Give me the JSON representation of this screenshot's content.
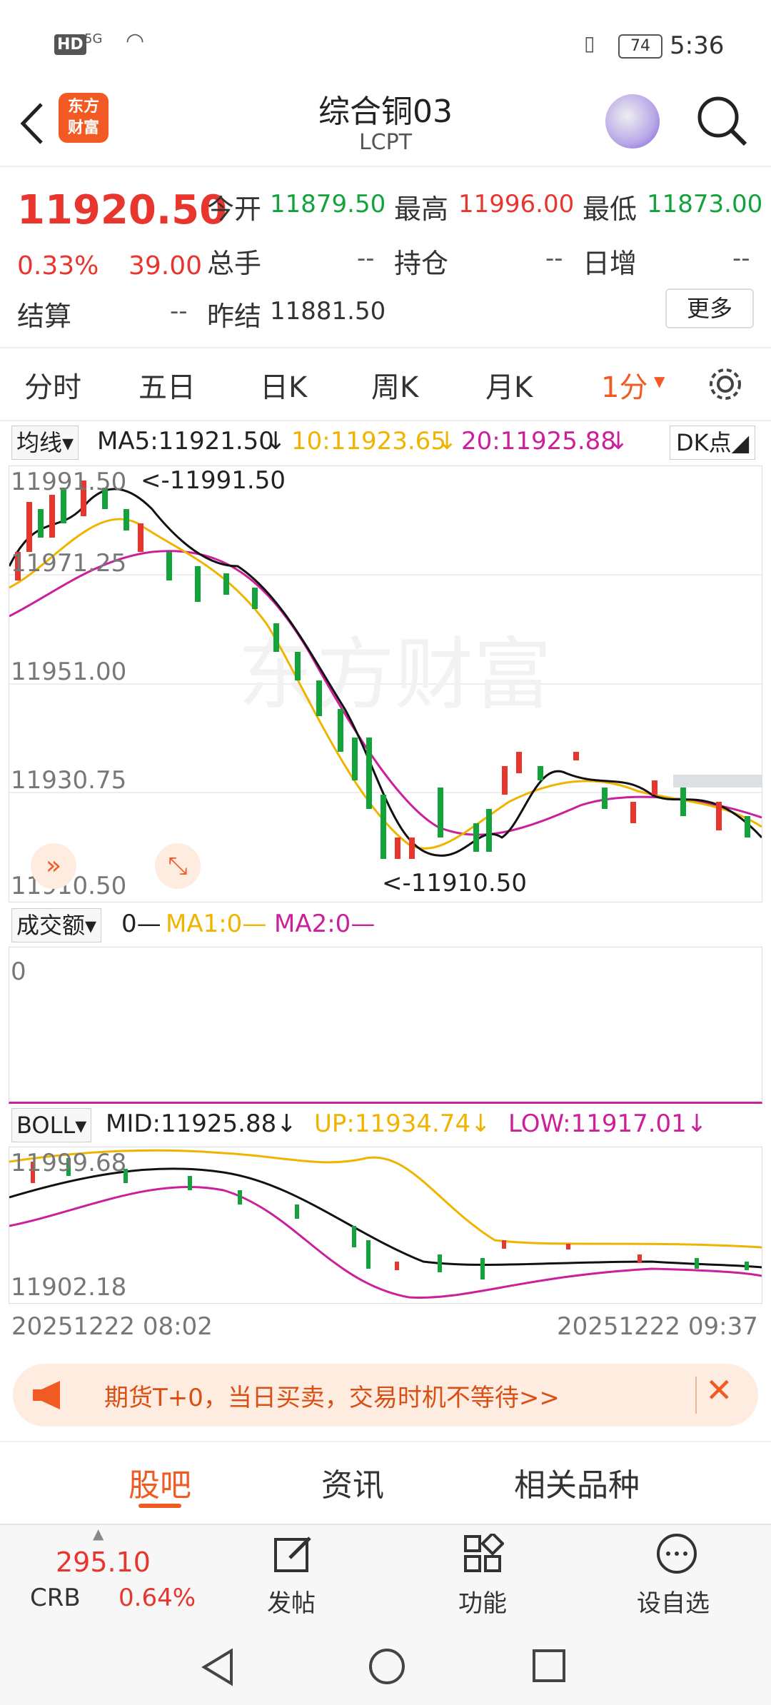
{
  "status": {
    "net": "HD",
    "signal": "5G",
    "battery": "74",
    "time": "5:36"
  },
  "header": {
    "logo_line1": "东方",
    "logo_line2": "财富",
    "title": "综合铜03",
    "code": "LCPT"
  },
  "quote": {
    "price": "11920.50",
    "change_pct": "0.33%",
    "change": "39.00",
    "open_label": "今开",
    "open": "11879.50",
    "high_label": "最高",
    "high": "11996.00",
    "low_label": "最低",
    "low": "11873.00",
    "volume_label": "总手",
    "volume": "--",
    "position_label": "持仓",
    "position": "--",
    "daily_inc_label": "日增",
    "daily_inc": "--",
    "settle_label": "结算",
    "settle": "--",
    "prev_settle_label": "昨结",
    "prev_settle": "11881.50",
    "more_button": "更多"
  },
  "tabs": {
    "t1": "分时",
    "t2": "五日",
    "t3": "日K",
    "t4": "周K",
    "t5": "月K",
    "t6": "1分"
  },
  "ma_legend": {
    "selector": "均线",
    "ma5": "MA5:11921.50",
    "ma10": "10:11923.65",
    "ma20": "20:11925.88",
    "dk": "DK点"
  },
  "main_chart": {
    "y1": "11991.50",
    "y2": "11971.25",
    "y3": "11951.00",
    "y4": "11930.75",
    "y5": "11910.50",
    "max_mark": "<-11991.50",
    "min_mark": "<-11910.50",
    "watermark": "东方财富"
  },
  "volume_legend": {
    "selector": "成交额",
    "val": "0",
    "ma1": "MA1:0",
    "ma2": "MA2:0",
    "zero": "0"
  },
  "boll_legend": {
    "selector": "BOLL",
    "mid": "MID:11925.88",
    "up": "UP:11934.74",
    "low": "LOW:11917.01",
    "y_top": "11999.68",
    "y_bottom": "11902.18"
  },
  "time_axis": {
    "start": "20251222 08:02",
    "end": "20251222 09:37"
  },
  "promo": {
    "text": "期货T+0，当日买卖，交易时机不等待>>"
  },
  "bottom_tabs": {
    "t1": "股吧",
    "t2": "资讯",
    "t3": "相关品种"
  },
  "toolbar": {
    "crb_value": "295.10",
    "crb_label": "CRB",
    "crb_pct": "0.64%",
    "post": "发帖",
    "func": "功能",
    "watch": "设自选"
  },
  "colors": {
    "up": "#e8352e",
    "down": "#12a33a",
    "ma10": "#f0b400",
    "ma20": "#cc1f9a",
    "accent": "#f15a22"
  }
}
